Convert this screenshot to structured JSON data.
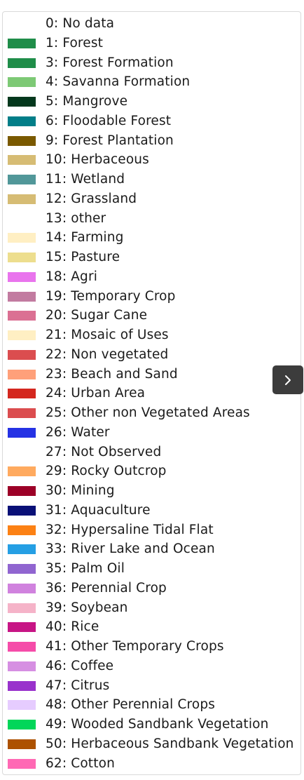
{
  "legend": {
    "items": [
      {
        "label": "0: No data",
        "color": "#ffffff"
      },
      {
        "label": "1: Forest",
        "color": "#1f8d49"
      },
      {
        "label": "3: Forest Formation",
        "color": "#1f8d49"
      },
      {
        "label": "4: Savanna Formation",
        "color": "#7dc975"
      },
      {
        "label": "5: Mangrove",
        "color": "#04381d"
      },
      {
        "label": "6: Floodable Forest",
        "color": "#027e88"
      },
      {
        "label": "9: Forest Plantation",
        "color": "#7a5900"
      },
      {
        "label": "10: Herbaceous",
        "color": "#d6bc74"
      },
      {
        "label": "11: Wetland",
        "color": "#519799"
      },
      {
        "label": "12: Grassland",
        "color": "#d6bc74"
      },
      {
        "label": "13: other",
        "color": "#ffffff"
      },
      {
        "label": "14: Farming",
        "color": "#ffefc3"
      },
      {
        "label": "15: Pasture",
        "color": "#edde8e"
      },
      {
        "label": "18: Agri",
        "color": "#e974ed"
      },
      {
        "label": "19: Temporary Crop",
        "color": "#c27ba0"
      },
      {
        "label": "20: Sugar Cane",
        "color": "#db7093"
      },
      {
        "label": "21: Mosaic of Uses",
        "color": "#ffefc3"
      },
      {
        "label": "22: Non vegetated",
        "color": "#db4d4f"
      },
      {
        "label": "23: Beach and Sand",
        "color": "#ffa07a"
      },
      {
        "label": "24: Urban Area",
        "color": "#d4271e"
      },
      {
        "label": "25: Other non Vegetated Areas",
        "color": "#db4d4f"
      },
      {
        "label": "26: Water",
        "color": "#2532e4"
      },
      {
        "label": "27: Not Observed",
        "color": "#ffffff"
      },
      {
        "label": "29: Rocky Outcrop",
        "color": "#ffaa5f"
      },
      {
        "label": "30: Mining",
        "color": "#9c0027"
      },
      {
        "label": "31: Aquaculture",
        "color": "#091077"
      },
      {
        "label": "32: Hypersaline Tidal Flat",
        "color": "#fc8114"
      },
      {
        "label": "33: River Lake and Ocean",
        "color": "#259fe4"
      },
      {
        "label": "35: Palm Oil",
        "color": "#9065d0"
      },
      {
        "label": "36: Perennial Crop",
        "color": "#d082de"
      },
      {
        "label": "39: Soybean",
        "color": "#f5b3c8"
      },
      {
        "label": "40: Rice",
        "color": "#c71585"
      },
      {
        "label": "41: Other Temporary Crops",
        "color": "#f54ca9"
      },
      {
        "label": "46: Coffee",
        "color": "#d68fe2"
      },
      {
        "label": "47: Citrus",
        "color": "#9932cc"
      },
      {
        "label": "48: Other Perennial Crops",
        "color": "#e6ccff"
      },
      {
        "label": "49: Wooded Sandbank Vegetation",
        "color": "#02d659"
      },
      {
        "label": "50: Herbaceous Sandbank Vegetation",
        "color": "#ad5100"
      },
      {
        "label": "62: Cotton",
        "color": "#ff69b4"
      }
    ]
  },
  "next_button": {
    "icon": "chevron-right-icon",
    "background": "#3c3c3c",
    "icon_color": "#ffffff"
  }
}
